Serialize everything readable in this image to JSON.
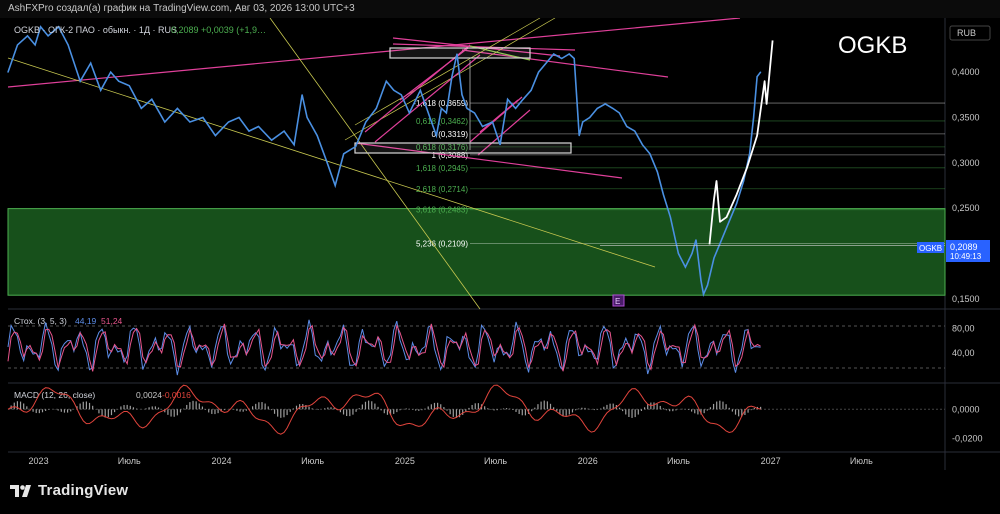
{
  "header": {
    "caption": "AshFXPro создал(а) график на TradingView.com, Авг 03, 2026 13:00 UTC+3"
  },
  "chart_data": [
    {
      "type": "line",
      "panel": "price",
      "legend": {
        "symbol": "OGKB · ОГК-2 ПАО · обыкн. · 1Д · RUS",
        "price": "0,2089",
        "change": "+0,0039 (+1,9…"
      },
      "ticker_watermark": "OGKB",
      "currency": "RUB",
      "y_ticks": [
        "0,4000",
        "0,3500",
        "0,3000",
        "0,2500",
        "0,2000",
        "0,1500"
      ],
      "ylim": [
        0.141,
        0.4575
      ],
      "x_ticks": [
        "2023",
        "Июль",
        "2024",
        "Июль",
        "2025",
        "Июль",
        "2026",
        "Июль",
        "2027",
        "Июль"
      ],
      "x_tick_dates": [
        "2023-01-01",
        "2023-07-01",
        "2024-01-01",
        "2024-07-01",
        "2025-01-01",
        "2025-07-01",
        "2026-01-01",
        "2026-07-01",
        "2027-01-01",
        "2027-07-01"
      ],
      "xlim": [
        "2022-11-01",
        "2027-12-15"
      ],
      "series": [
        {
          "color": "#4a90e2",
          "points": [
            [
              "2022-11-01",
              0.4
            ],
            [
              "2022-11-20",
              0.43
            ],
            [
              "2022-12-10",
              0.44
            ],
            [
              "2022-12-25",
              0.43
            ],
            [
              "2023-01-05",
              0.45
            ],
            [
              "2023-01-20",
              0.44
            ],
            [
              "2023-02-10",
              0.45
            ],
            [
              "2023-03-01",
              0.43
            ],
            [
              "2023-03-25",
              0.39
            ],
            [
              "2023-04-15",
              0.41
            ],
            [
              "2023-05-05",
              0.38
            ],
            [
              "2023-05-25",
              0.4
            ],
            [
              "2023-06-10",
              0.39
            ],
            [
              "2023-07-01",
              0.385
            ],
            [
              "2023-07-25",
              0.36
            ],
            [
              "2023-08-15",
              0.37
            ],
            [
              "2023-09-10",
              0.345
            ],
            [
              "2023-10-05",
              0.36
            ],
            [
              "2023-10-30",
              0.345
            ],
            [
              "2023-11-25",
              0.35
            ],
            [
              "2023-12-20",
              0.33
            ],
            [
              "2024-01-15",
              0.345
            ],
            [
              "2024-02-05",
              0.35
            ],
            [
              "2024-02-25",
              0.335
            ],
            [
              "2024-03-15",
              0.34
            ],
            [
              "2024-04-10",
              0.325
            ],
            [
              "2024-05-05",
              0.335
            ],
            [
              "2024-05-25",
              0.32
            ],
            [
              "2024-06-10",
              0.375
            ],
            [
              "2024-06-20",
              0.35
            ],
            [
              "2024-07-10",
              0.33
            ],
            [
              "2024-07-30",
              0.3
            ],
            [
              "2024-08-15",
              0.275
            ],
            [
              "2024-09-01",
              0.31
            ],
            [
              "2024-09-25",
              0.318
            ],
            [
              "2024-10-15",
              0.345
            ],
            [
              "2024-11-05",
              0.36
            ],
            [
              "2024-11-25",
              0.39
            ],
            [
              "2024-12-10",
              0.38
            ],
            [
              "2024-12-25",
              0.375
            ],
            [
              "2025-01-10",
              0.355
            ],
            [
              "2025-02-01",
              0.38
            ],
            [
              "2025-02-20",
              0.35
            ],
            [
              "2025-03-05",
              0.33
            ],
            [
              "2025-03-15",
              0.36
            ],
            [
              "2025-03-25",
              0.355
            ],
            [
              "2025-04-05",
              0.395
            ],
            [
              "2025-04-15",
              0.42
            ],
            [
              "2025-04-25",
              0.375
            ],
            [
              "2025-05-05",
              0.36
            ],
            [
              "2025-05-20",
              0.355
            ],
            [
              "2025-06-05",
              0.34
            ],
            [
              "2025-06-25",
              0.345
            ],
            [
              "2025-07-10",
              0.32
            ],
            [
              "2025-07-25",
              0.37
            ],
            [
              "2025-08-10",
              0.36
            ],
            [
              "2025-08-25",
              0.37
            ],
            [
              "2025-09-10",
              0.38
            ],
            [
              "2025-09-25",
              0.4
            ],
            [
              "2025-10-10",
              0.41
            ],
            [
              "2025-10-25",
              0.42
            ],
            [
              "2025-11-10",
              0.415
            ],
            [
              "2025-11-25",
              0.42
            ],
            [
              "2025-12-05",
              0.415
            ],
            [
              "2025-12-15",
              0.33
            ],
            [
              "2025-12-22",
              0.345
            ],
            [
              "2026-01-05",
              0.35
            ],
            [
              "2026-01-20",
              0.36
            ],
            [
              "2026-02-05",
              0.365
            ],
            [
              "2026-02-20",
              0.36
            ],
            [
              "2026-03-05",
              0.355
            ],
            [
              "2026-03-20",
              0.34
            ],
            [
              "2026-04-05",
              0.335
            ],
            [
              "2026-04-20",
              0.32
            ],
            [
              "2026-05-05",
              0.31
            ],
            [
              "2026-05-20",
              0.29
            ],
            [
              "2026-06-01",
              0.265
            ],
            [
              "2026-06-15",
              0.24
            ],
            [
              "2026-07-01",
              0.2
            ],
            [
              "2026-07-15",
              0.185
            ],
            [
              "2026-07-28",
              0.2
            ],
            [
              "2026-08-05",
              0.215
            ],
            [
              "2026-08-15",
              0.17
            ],
            [
              "2026-08-20",
              0.155
            ],
            [
              "2026-08-28",
              0.165
            ],
            [
              "2026-09-10",
              0.195
            ],
            [
              "2026-09-25",
              0.215
            ],
            [
              "2026-10-10",
              0.235
            ],
            [
              "2026-10-25",
              0.255
            ],
            [
              "2026-11-08",
              0.28
            ],
            [
              "2026-11-20",
              0.31
            ],
            [
              "2026-11-28",
              0.35
            ],
            [
              "2026-12-05",
              0.395
            ],
            [
              "2026-12-12",
              0.4
            ]
          ]
        }
      ],
      "fib_levels": [
        {
          "label": "-1,618 (0,3659)",
          "value": 0.3659,
          "color": "#ffffff"
        },
        {
          "label": "0,618 (0,3462)",
          "value": 0.3462,
          "color": "#4caf50"
        },
        {
          "label": "0 (0,3319)",
          "value": 0.3319,
          "color": "#ffffff"
        },
        {
          "label": "0,618 (0,3176)",
          "value": 0.3176,
          "color": "#4caf50"
        },
        {
          "label": "1 (0,3088)",
          "value": 0.3088,
          "color": "#ffffff"
        },
        {
          "label": "1,618 (0,2945)",
          "value": 0.2945,
          "color": "#4caf50"
        },
        {
          "label": "2,618 (0,2714)",
          "value": 0.2714,
          "color": "#4caf50"
        },
        {
          "label": "3,618 (0,2483)",
          "value": 0.2483,
          "color": "#4caf50"
        },
        {
          "label": "5,236 (0,2109)",
          "value": 0.2109,
          "color": "#ffffff"
        }
      ],
      "support_zone": {
        "low": 0.154,
        "high": 0.2495,
        "color": "#1b5e20"
      },
      "last_price_tag": {
        "symbol": "OGKB",
        "price": "0,2089",
        "countdown": "10:49:13",
        "color": "#2962ff"
      },
      "event_marker": "E",
      "projection": {
        "color": "#ffffff",
        "points": [
          [
            "2026-09-01",
            0.21
          ],
          [
            "2026-09-10",
            0.26
          ],
          [
            "2026-09-15",
            0.28
          ],
          [
            "2026-09-22",
            0.235
          ],
          [
            "2026-10-05",
            0.24
          ],
          [
            "2026-10-25",
            0.265
          ],
          [
            "2026-11-15",
            0.295
          ],
          [
            "2026-12-05",
            0.33
          ],
          [
            "2026-12-15",
            0.37
          ],
          [
            "2026-12-20",
            0.39
          ],
          [
            "2026-12-24",
            0.365
          ],
          [
            "2027-01-05",
            0.435
          ]
        ]
      }
    },
    {
      "type": "line",
      "panel": "stochastic",
      "label": "Стох. (3, 5, 3)",
      "values_text": [
        "44,19",
        "51,24"
      ],
      "y_ticks": [
        "80,00",
        "40,00"
      ],
      "ylim": [
        -5,
        105
      ],
      "series": [
        {
          "name": "%K",
          "color": "#5c8de8"
        },
        {
          "name": "%D",
          "color": "#e8558c"
        }
      ]
    },
    {
      "type": "bar",
      "panel": "macd",
      "label": "MACD (12, 26, close)",
      "values_text": [
        "0,0024",
        "-0,0016"
      ],
      "y_ticks": [
        "0,0000",
        "-0,0200"
      ],
      "ylim": [
        -0.028,
        0.016
      ]
    }
  ],
  "branding": {
    "logo": "TradingView"
  }
}
